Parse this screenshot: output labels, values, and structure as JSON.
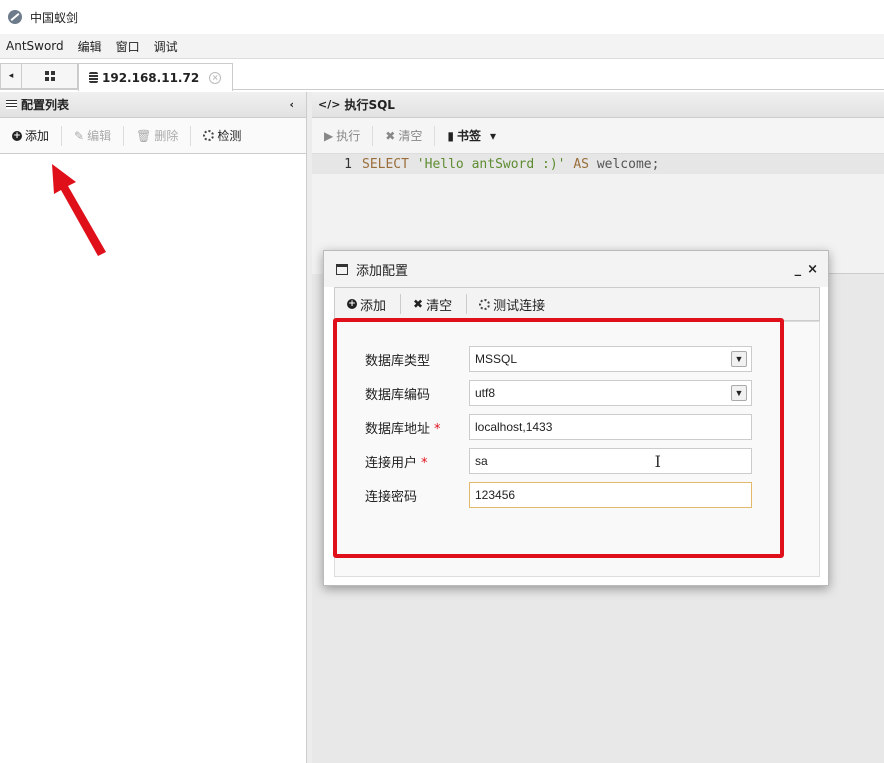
{
  "window": {
    "title": "中国蚁剑"
  },
  "menu": [
    "AntSword",
    "编辑",
    "窗口",
    "调试"
  ],
  "tabs": {
    "prev_icon": "◂",
    "host": "192.168.11.72",
    "close": "×"
  },
  "left_panel": {
    "title": "配置列表",
    "collapse": "‹",
    "toolbar": {
      "add": "添加",
      "edit": "编辑",
      "delete": "删除",
      "detect": "检测"
    }
  },
  "sql_panel": {
    "title": "执行SQL",
    "toolbar": {
      "execute": "执行",
      "clear": "清空",
      "bookmark": "书签"
    },
    "editor": {
      "line_number": "1",
      "kw1": "SELECT",
      "str": "'Hello antSword :)'",
      "kw2": "AS",
      "rest": "welcome;"
    }
  },
  "dialog": {
    "title": "添加配置",
    "minimize": "_",
    "close": "×",
    "toolbar": {
      "add": "添加",
      "clear": "清空",
      "test": "测试连接"
    },
    "form": {
      "db_type": {
        "label": "数据库类型",
        "value": "MSSQL"
      },
      "db_encoding": {
        "label": "数据库编码",
        "value": "utf8"
      },
      "db_address": {
        "label": "数据库地址",
        "value": "localhost,1433",
        "required": "*"
      },
      "db_user": {
        "label": "连接用户",
        "value": "sa",
        "required": "*"
      },
      "db_password": {
        "label": "连接密码",
        "value": "123456"
      }
    }
  },
  "colors": {
    "highlight": "#e0101b",
    "arrow": "#e0101b",
    "focus_border": "#e2b96a"
  }
}
